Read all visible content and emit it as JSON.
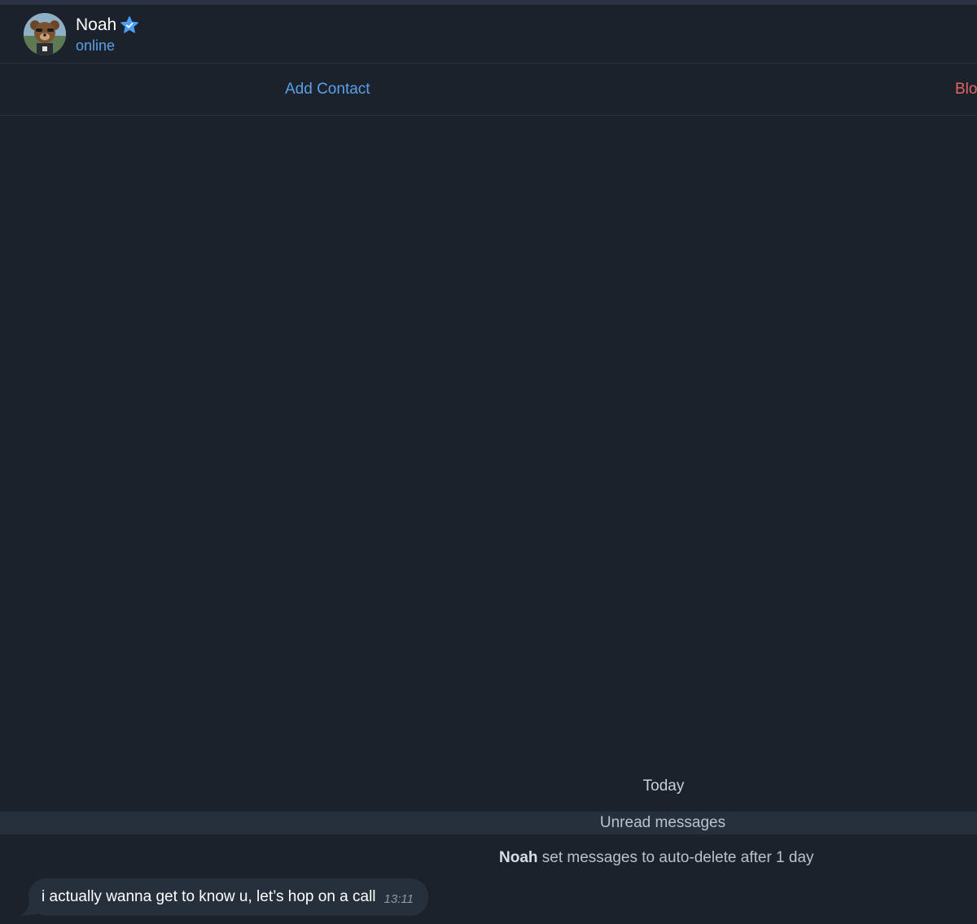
{
  "header": {
    "contact_name": "Noah",
    "status": "online",
    "icons": {
      "avatar": "bear-avatar",
      "verified": "star-badge-icon"
    }
  },
  "actions": {
    "add_contact": "Add Contact",
    "block": "Blo"
  },
  "chat": {
    "date_separator": "Today",
    "unread_label": "Unread messages",
    "service_message": {
      "name": "Noah",
      "text": " set messages to auto-delete after 1 day"
    },
    "messages": [
      {
        "text": "i actually wanna get to know u, let’s hop on a call",
        "time": "13:11"
      }
    ]
  },
  "colors": {
    "background": "#1c222b",
    "accent": "#5aa0e8",
    "danger": "#e06666",
    "bubble": "#262f3c"
  }
}
